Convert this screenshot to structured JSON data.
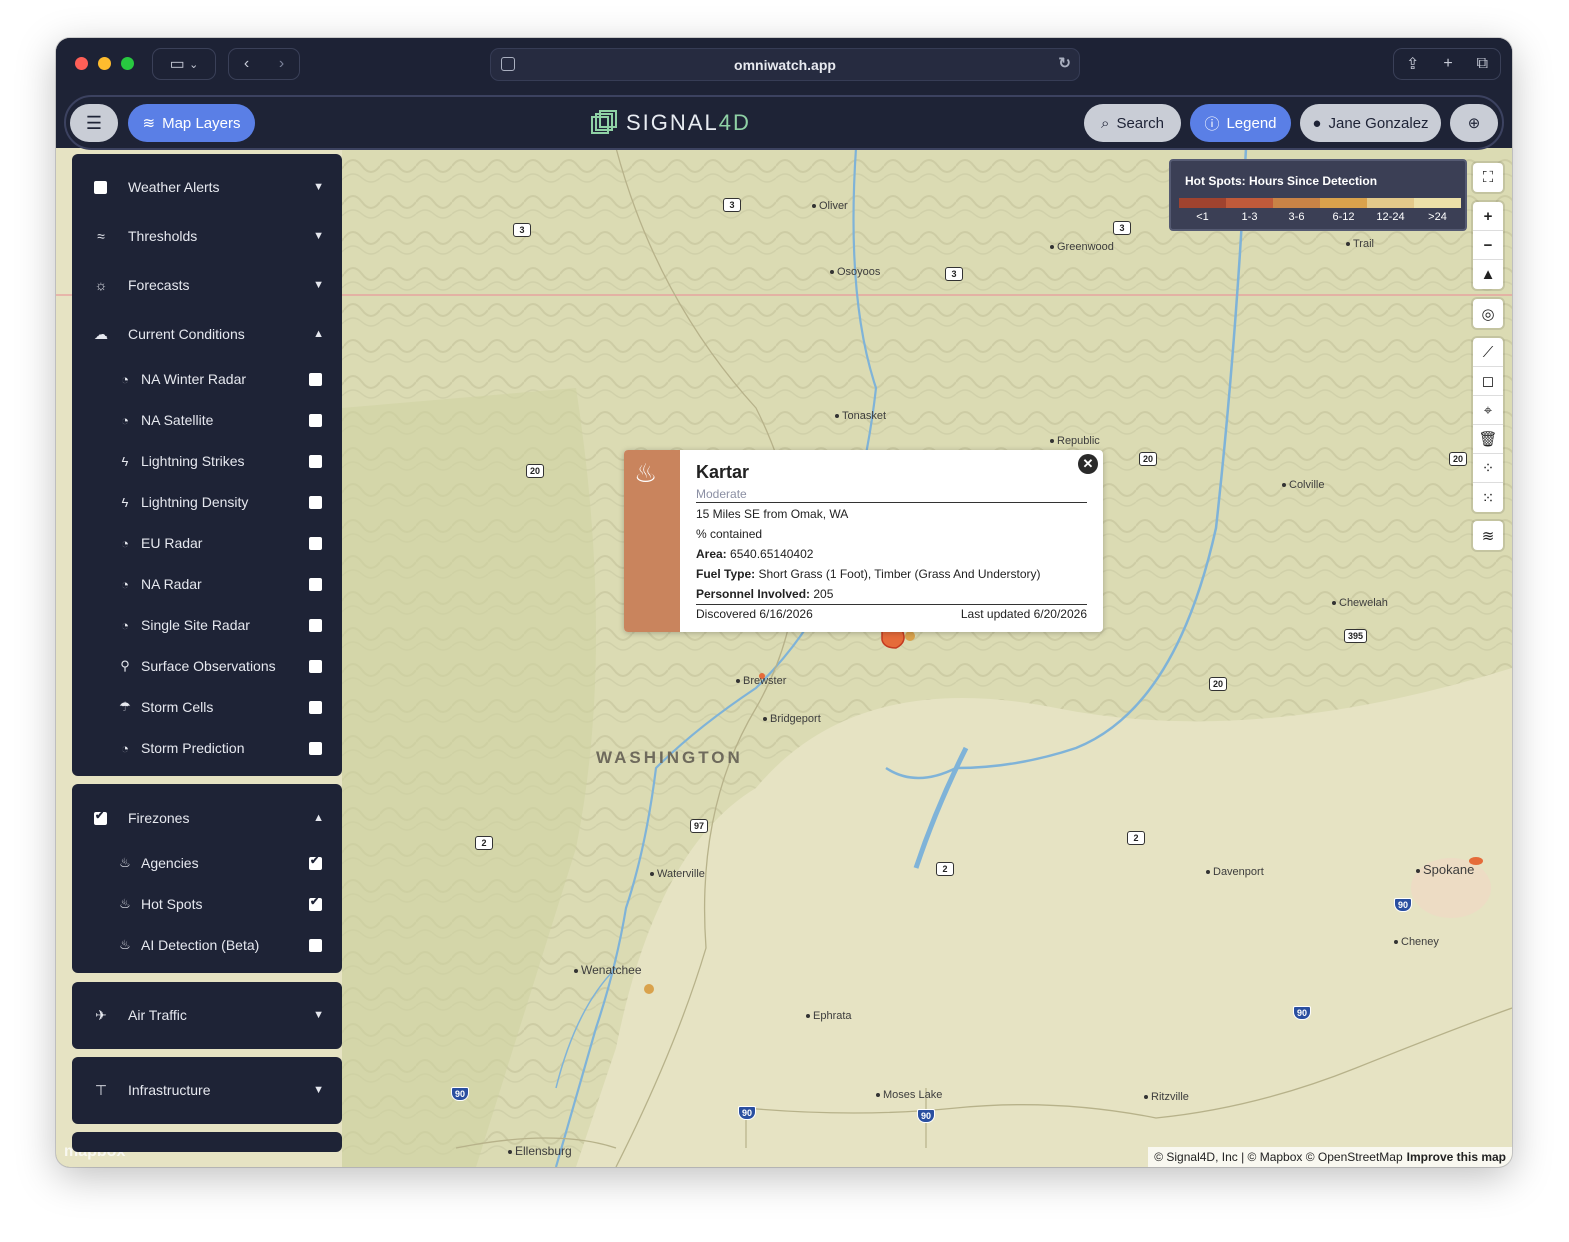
{
  "browser": {
    "url": "omniwatch.app"
  },
  "header": {
    "map_layers_label": "Map Layers",
    "search_label": "Search",
    "legend_label": "Legend",
    "user_name": "Jane Gonzalez",
    "logo_text": "SIGNAL",
    "logo_suffix": "4D"
  },
  "sidebar": {
    "sections": [
      {
        "label": "Weather Alerts",
        "icon": "square-icon",
        "expanded": false
      },
      {
        "label": "Thresholds",
        "icon": "wind-icon",
        "expanded": false
      },
      {
        "label": "Forecasts",
        "icon": "forecast-icon",
        "expanded": false
      },
      {
        "label": "Current Conditions",
        "icon": "cloud-icon",
        "expanded": true
      }
    ],
    "current_conditions_items": [
      {
        "label": "NA Winter Radar",
        "icon": "radar-icon",
        "checked": false
      },
      {
        "label": "NA Satellite",
        "icon": "radar-icon",
        "checked": false
      },
      {
        "label": "Lightning Strikes",
        "icon": "lightning-icon",
        "checked": false
      },
      {
        "label": "Lightning Density",
        "icon": "lightning-icon",
        "checked": false
      },
      {
        "label": "EU Radar",
        "icon": "radar-icon",
        "checked": false
      },
      {
        "label": "NA Radar",
        "icon": "radar-icon",
        "checked": false
      },
      {
        "label": "Single Site Radar",
        "icon": "radar-icon",
        "checked": false
      },
      {
        "label": "Surface Observations",
        "icon": "pin-icon",
        "checked": false
      },
      {
        "label": "Storm Cells",
        "icon": "storm-icon",
        "checked": false
      },
      {
        "label": "Storm Prediction",
        "icon": "radar-icon",
        "checked": false
      }
    ],
    "firezones": {
      "label": "Firezones",
      "checked": true,
      "items": [
        {
          "label": "Agencies",
          "icon": "fire-icon",
          "checked": true
        },
        {
          "label": "Hot Spots",
          "icon": "fire-icon",
          "checked": true
        },
        {
          "label": "AI Detection (Beta)",
          "icon": "fire-icon",
          "checked": false
        }
      ]
    },
    "air_traffic_label": "Air Traffic",
    "infrastructure_label": "Infrastructure"
  },
  "legend": {
    "title": "Hot Spots: Hours Since Detection",
    "bins": [
      {
        "label": "<1",
        "color": "#a0432f"
      },
      {
        "label": "1-3",
        "color": "#c05a3a"
      },
      {
        "label": "3-6",
        "color": "#c98346"
      },
      {
        "label": "6-12",
        "color": "#d9a24c"
      },
      {
        "label": "12-24",
        "color": "#e3c98a"
      },
      {
        "label": ">24",
        "color": "#ece0a8"
      }
    ]
  },
  "popup": {
    "title": "Kartar",
    "severity": "Moderate",
    "location": "15 Miles SE from Omak, WA",
    "contained": "% contained",
    "area_label": "Area:",
    "area_value": "6540.65140402",
    "fuel_label": "Fuel Type:",
    "fuel_value": "Short Grass (1 Foot), Timber (Grass And Understory)",
    "personnel_label": "Personnel Involved:",
    "personnel_value": "205",
    "discovered": "Discovered 6/16/2026",
    "updated": "Last updated 6/20/2026",
    "accent_color": "#c9845d"
  },
  "map": {
    "state_label": "WASHINGTON",
    "places": [
      "Oliver",
      "Osoyoos",
      "Greenwood",
      "Trail",
      "Tonasket",
      "Republic",
      "Colville",
      "Chewelah",
      "Brewster",
      "Bridgeport",
      "Waterville",
      "Wenatchee",
      "Davenport",
      "Spokane",
      "Cheney",
      "Ephrata",
      "Moses Lake",
      "Ritzville",
      "Ellensburg"
    ],
    "shields": [
      "3",
      "3",
      "3",
      "3",
      "20",
      "20",
      "20",
      "20",
      "395",
      "2",
      "97",
      "2",
      "2",
      "2",
      "90",
      "90",
      "90",
      "90",
      "90"
    ],
    "attribution": "© Signal4D, Inc | © Mapbox © OpenStreetMap",
    "improve": "Improve this map",
    "mapbox": "mapbox"
  }
}
